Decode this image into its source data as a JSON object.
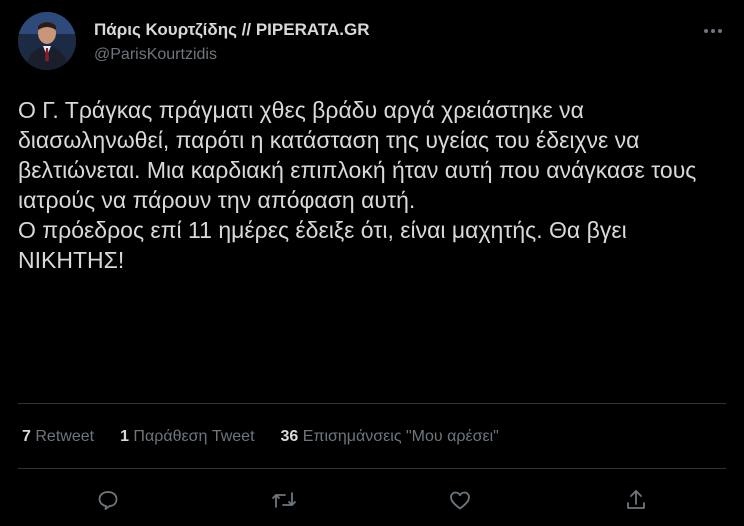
{
  "author": {
    "name": "Πάρις Κουρτζίδης // PIPERATA.GR",
    "handle": "@ParisKourtzidis"
  },
  "tweet": {
    "text": "Ο Γ. Τράγκας πράγματι χθες βράδυ αργά χρειάστηκε να διασωληνωθεί, παρότι η κατάσταση της υγείας του έδειχνε να βελτιώνεται. Μια καρδιακή επιπλοκή ήταν αυτή που ανάγκασε τους ιατρούς να πάρουν την απόφαση αυτή.\nΟ πρόεδρος επί 11 ημέρες έδειξε ότι, είναι μαχητής. Θα βγει ΝΙΚΗΤΗΣ!"
  },
  "stats": {
    "retweets_count": "7",
    "retweets_label": "Retweet",
    "quotes_count": "1",
    "quotes_label": "Παράθεση Tweet",
    "likes_count": "36",
    "likes_label": "Επισημάνσεις \"Μου αρέσει\""
  },
  "icons": {
    "more": "more-dots-icon",
    "reply": "reply-icon",
    "retweet": "retweet-icon",
    "like": "heart-icon",
    "share": "share-icon"
  },
  "colors": {
    "background": "#000000",
    "text": "#d9d9d9",
    "secondary": "#6e767d",
    "divider": "#2f3336"
  }
}
